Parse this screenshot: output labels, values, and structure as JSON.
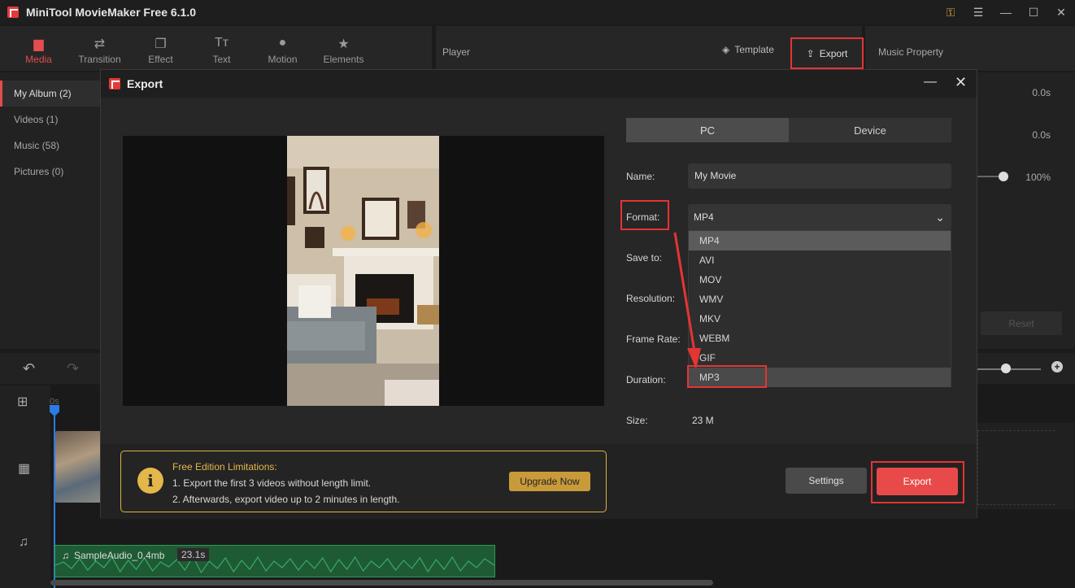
{
  "app": {
    "title": "MiniTool MovieMaker Free 6.1.0"
  },
  "toolbar": {
    "tabs": [
      {
        "label": "Media",
        "icon": "folder-icon"
      },
      {
        "label": "Transition",
        "icon": "transition-icon"
      },
      {
        "label": "Effect",
        "icon": "effect-icon"
      },
      {
        "label": "Text",
        "icon": "text-icon"
      },
      {
        "label": "Motion",
        "icon": "motion-icon"
      },
      {
        "label": "Elements",
        "icon": "elements-icon"
      }
    ]
  },
  "player": {
    "label": "Player",
    "template_label": "Template",
    "export_label": "Export"
  },
  "music_property": {
    "label": "Music Property",
    "values": [
      "0.0s",
      "0.0s",
      "100%"
    ],
    "reset_label": "Reset"
  },
  "media": {
    "albums": [
      {
        "label": "My Album (2)"
      },
      {
        "label": "Videos (1)"
      },
      {
        "label": "Music (58)"
      },
      {
        "label": "Pictures (0)"
      }
    ]
  },
  "timeline": {
    "ruler_start": "0s",
    "audio_clip": {
      "name": "SampleAudio_0.4mb",
      "duration": "23.1s"
    }
  },
  "dialog": {
    "title": "Export",
    "tabs": {
      "pc": "PC",
      "device": "Device"
    },
    "labels": {
      "name": "Name:",
      "format": "Format:",
      "save_to": "Save to:",
      "resolution": "Resolution:",
      "frame_rate": "Frame Rate:",
      "duration": "Duration:",
      "size": "Size:"
    },
    "name_value": "My Movie",
    "format_value": "MP4",
    "format_options": [
      "MP4",
      "AVI",
      "MOV",
      "WMV",
      "MKV",
      "WEBM",
      "GIF",
      "MP3"
    ],
    "size_value": "23 M",
    "limits": {
      "title": "Free Edition Limitations:",
      "line1": "1. Export the first 3 videos without length limit.",
      "line2": "2. Afterwards, export video up to 2 minutes in length."
    },
    "upgrade_label": "Upgrade Now",
    "settings_label": "Settings",
    "export_label": "Export"
  },
  "colors": {
    "accent": "#e84a4a",
    "highlight": "#e53434",
    "warning": "#e3b74a"
  }
}
